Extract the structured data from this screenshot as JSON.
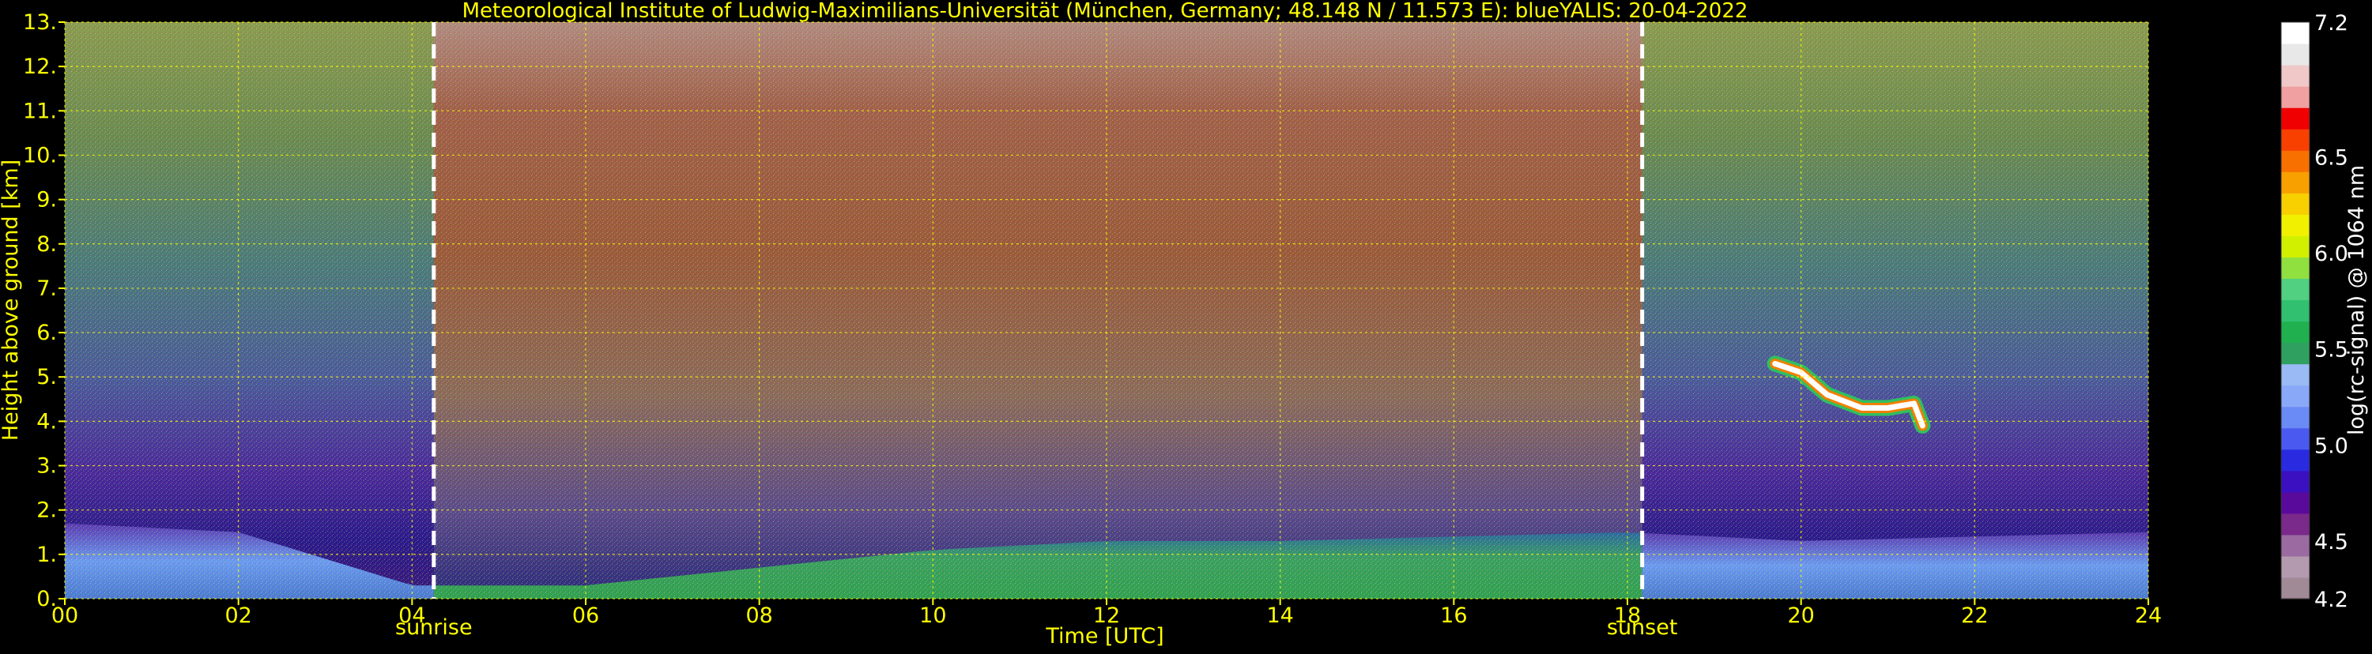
{
  "chart_data": {
    "type": "heatmap",
    "title": "Meteorological Institute of Ludwig-Maximilians-Universität (München, Germany; 48.148 N / 11.573 E):    blueYALIS: 20-04-2022",
    "xlabel": "Time [UTC]",
    "ylabel": "Height above ground [km]",
    "xlim": [
      0,
      24
    ],
    "ylim": [
      0,
      13
    ],
    "x_ticks": [
      "00",
      "02",
      "04",
      "06",
      "08",
      "10",
      "12",
      "14",
      "16",
      "18",
      "20",
      "22",
      "24"
    ],
    "y_ticks": [
      "0.",
      "1.",
      "2.",
      "3.",
      "4.",
      "5.",
      "6.",
      "7.",
      "8.",
      "9.",
      "10.",
      "11.",
      "12.",
      "13."
    ],
    "grid": true,
    "markers": [
      {
        "label": "sunrise",
        "x": 4.25
      },
      {
        "label": "sunset",
        "x": 18.17
      }
    ],
    "colorbar": {
      "label": "log(rc-signal) @ 1064 nm",
      "range": [
        4.2,
        7.2
      ],
      "ticks": [
        "4.2",
        "4.5",
        "5.0",
        "5.5",
        "6.0",
        "6.5",
        "7.2"
      ],
      "colors": [
        "#a08a96",
        "#b49aae",
        "#9a6aa0",
        "#7a2a8a",
        "#5a0a9a",
        "#3a10c0",
        "#2a2ae0",
        "#4a5af0",
        "#6a8af5",
        "#8aa8f8",
        "#9abaf5",
        "#30a060",
        "#20b050",
        "#30c070",
        "#50d080",
        "#90e040",
        "#d0f000",
        "#f0f000",
        "#f8d000",
        "#f8a000",
        "#f87000",
        "#f84000",
        "#f00000",
        "#f0a0a0",
        "#f0c8c8",
        "#e8e8e8",
        "#ffffff"
      ]
    },
    "boundary_layer_top_km": {
      "x": [
        0,
        2,
        4,
        6,
        8,
        10,
        12,
        14,
        16,
        18,
        20,
        22,
        24
      ],
      "y": [
        1.7,
        1.5,
        0.3,
        0.3,
        0.7,
        1.1,
        1.3,
        1.3,
        1.4,
        1.5,
        1.3,
        1.4,
        1.5
      ]
    },
    "cloud_layer": {
      "x": [
        19.7,
        20.0,
        20.3,
        20.7,
        21.0,
        21.3,
        21.4
      ],
      "y": [
        5.3,
        5.1,
        4.6,
        4.3,
        4.3,
        4.4,
        3.9
      ]
    }
  }
}
